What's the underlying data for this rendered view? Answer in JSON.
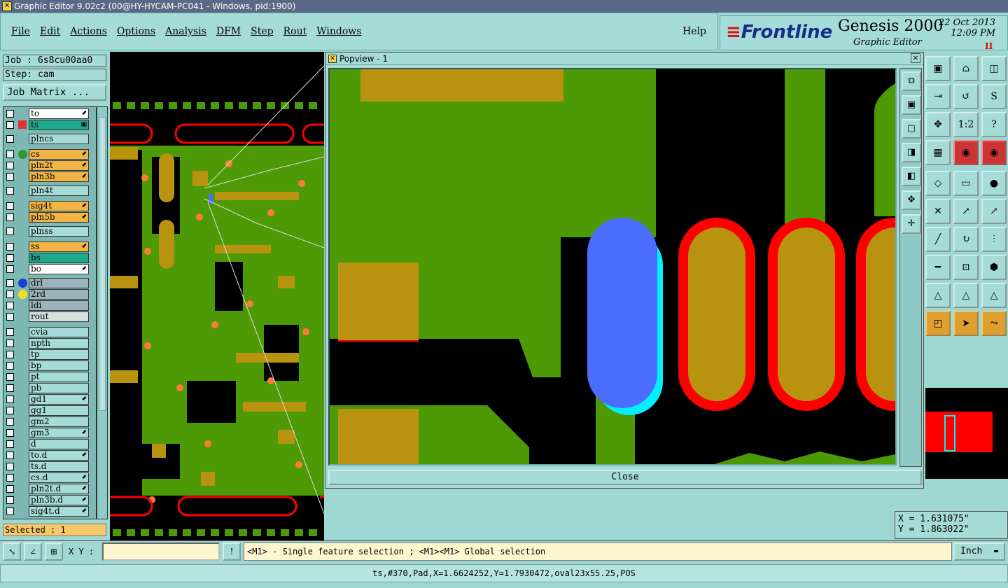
{
  "window": {
    "title": "Graphic Editor 9.02c2 (00@HY-HYCAM-PC041 - Windows, pid:1900)"
  },
  "menu": {
    "items": [
      {
        "label": "File"
      },
      {
        "label": "Edit"
      },
      {
        "label": "Actions"
      },
      {
        "label": "Options"
      },
      {
        "label": "Analysis"
      },
      {
        "label": "DFM"
      },
      {
        "label": "Step"
      },
      {
        "label": "Rout"
      },
      {
        "label": "Windows"
      }
    ],
    "help": "Help"
  },
  "brand": {
    "logo": "Frontline",
    "product": "Genesis 2000",
    "subtitle": "Graphic Editor",
    "date": "22 Oct 2013",
    "time": "12:09 PM",
    "rec_indicator": "II"
  },
  "left": {
    "job": "Job : 6s8cu00aa0",
    "step": "Step: cam",
    "job_matrix": "Job Matrix ...",
    "selected": "Selected : 1",
    "layers": [
      {
        "name": "to",
        "bg": "#ffffff",
        "arrow": "⬋"
      },
      {
        "name": "ts",
        "bg": "#1fa98c",
        "arrow": "▣",
        "active": true
      },
      {
        "name": "plncs",
        "bg": "#a6dcd8"
      },
      {
        "name": "cs",
        "bg": "#f2b545",
        "arrow": "⬋",
        "dot": "#2e9a2e"
      },
      {
        "name": "pln2t",
        "bg": "#f2b545",
        "arrow": "⬋"
      },
      {
        "name": "pln3b",
        "bg": "#f2b545",
        "arrow": "⬋"
      },
      {
        "name": "pln4t",
        "bg": "#a6dcd8"
      },
      {
        "name": "sig4t",
        "bg": "#f2b545",
        "arrow": "⬋"
      },
      {
        "name": "pln5b",
        "bg": "#f2b545",
        "arrow": "⬋"
      },
      {
        "name": "plnss",
        "bg": "#a6dcd8"
      },
      {
        "name": "ss",
        "bg": "#f2b545",
        "arrow": "⬋"
      },
      {
        "name": "bs",
        "bg": "#1fa98c"
      },
      {
        "name": "bo",
        "bg": "#ffffff",
        "arrow": "⬋"
      },
      {
        "name": "drl",
        "bg": "#9bb4bc",
        "dot": "#1a3cd8"
      },
      {
        "name": "2rd",
        "bg": "#9bb4bc",
        "dot": "#f2e020"
      },
      {
        "name": "ldi",
        "bg": "#9bb4bc"
      },
      {
        "name": "rout",
        "bg": "#d8dede"
      },
      {
        "name": "cvia",
        "bg": "#a6dcd8"
      },
      {
        "name": "npth",
        "bg": "#a6dcd8"
      },
      {
        "name": "tp",
        "bg": "#a6dcd8"
      },
      {
        "name": "bp",
        "bg": "#a6dcd8"
      },
      {
        "name": "pt",
        "bg": "#a6dcd8"
      },
      {
        "name": "pb",
        "bg": "#a6dcd8"
      },
      {
        "name": "gd1",
        "bg": "#a6dcd8",
        "arrow": "⬋"
      },
      {
        "name": "gg1",
        "bg": "#a6dcd8"
      },
      {
        "name": "gm2",
        "bg": "#a6dcd8"
      },
      {
        "name": "gm3",
        "bg": "#a6dcd8",
        "arrow": "⬋"
      },
      {
        "name": "d",
        "bg": "#a6dcd8"
      },
      {
        "name": "to.d",
        "bg": "#a6dcd8",
        "arrow": "⬋"
      },
      {
        "name": "ts.d",
        "bg": "#a6dcd8"
      },
      {
        "name": "cs.d",
        "bg": "#a6dcd8",
        "arrow": "⬋"
      },
      {
        "name": "pln2t.d",
        "bg": "#a6dcd8",
        "arrow": "⬋"
      },
      {
        "name": "pln3b.d",
        "bg": "#a6dcd8",
        "arrow": "⬋"
      },
      {
        "name": "sig4t.d",
        "bg": "#a6dcd8",
        "arrow": "⬋"
      }
    ]
  },
  "popview": {
    "title": "Popview - 1",
    "close": "Close",
    "close_x": "×"
  },
  "coords": {
    "x": "X = 1.631075\"",
    "y": "Y = 1.863022\""
  },
  "bottom": {
    "xy_label": "X Y :",
    "xy_value": "",
    "alert": "!",
    "prompt": "<M1> - Single feature selection ; <M1><M1> Global selection",
    "unit": "Inch",
    "unit_arrow": "▬"
  },
  "status": "ts,#370,Pad,X=1.6624252,Y=1.7930472,oval23x55.25,POS",
  "colors": {
    "copper": "#4e9a06",
    "pad": "#b79310",
    "red": "#ff0000",
    "blue": "#4a6cff",
    "cyan": "#00f0ff"
  },
  "icons": {
    "right_tools": [
      "camera-icon",
      "home-icon",
      "window-icon",
      "import-icon",
      "return-icon",
      "s-curve-icon",
      "move-icon",
      "ratio-icon",
      "help-icon",
      "grid-icon",
      "layer-red-icon",
      "layer-red2-icon",
      "edit-shape-icon",
      "ruler-icon",
      "circle-icon",
      "delete-icon",
      "line-add-icon",
      "move-dot-icon",
      "diagonal-icon",
      "rotate-icon",
      "split-icon",
      "line-icon",
      "resize-icon",
      "shape-icon",
      "arc-icon",
      "arc2-icon",
      "arc3-icon",
      "select-box-icon",
      "pointer-icon",
      "path-icon"
    ],
    "ratio_label": "1:2"
  }
}
